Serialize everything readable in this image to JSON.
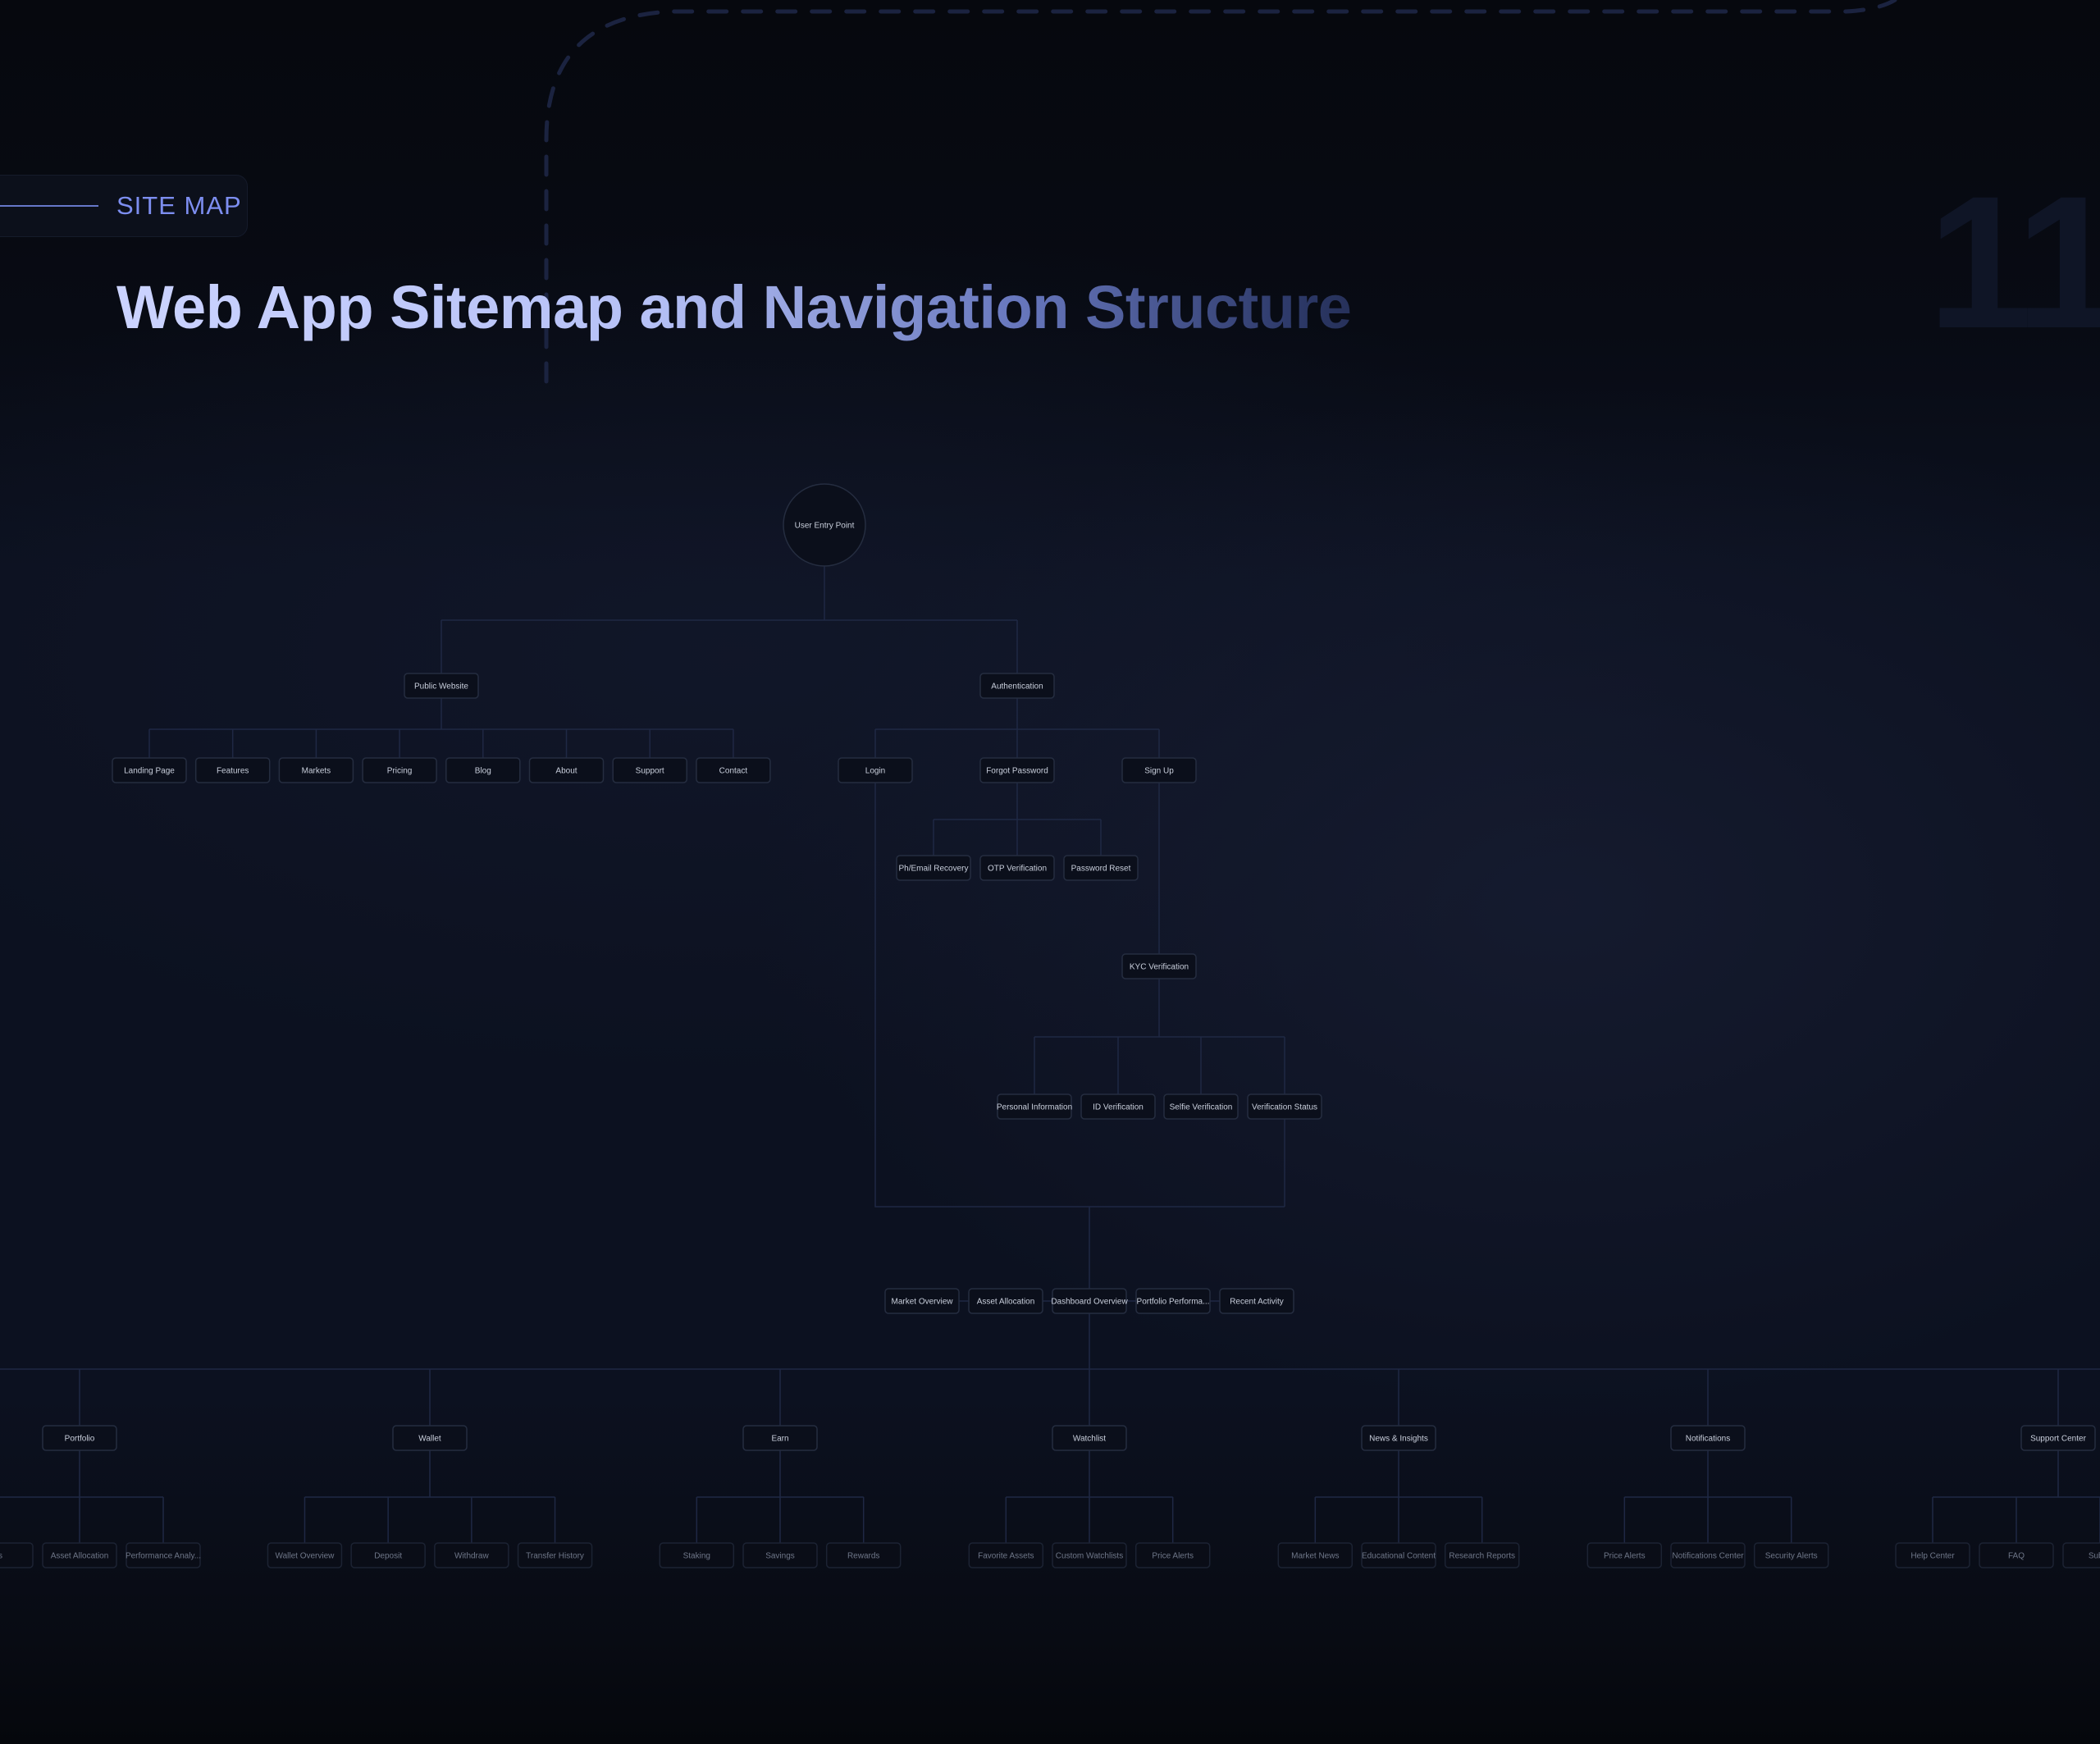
{
  "header": {
    "section_label": "SITE MAP",
    "title": "Web App Sitemap and Navigation Structure",
    "page_number": "11"
  },
  "sitemap": {
    "root": "User Entry Point",
    "public_website": {
      "label": "Public Website",
      "children": [
        "Landing Page",
        "Features",
        "Markets",
        "Pricing",
        "Blog",
        "About",
        "Support",
        "Contact"
      ]
    },
    "authentication": {
      "label": "Authentication",
      "login": "Login",
      "forgot_password": {
        "label": "Forgot Password",
        "children": [
          "Ph/Email Recovery",
          "OTP Verification",
          "Password Reset"
        ]
      },
      "sign_up": "Sign Up",
      "kyc": {
        "label": "KYC Verification",
        "children": [
          "Personal Information",
          "ID Verification",
          "Selfie Verification",
          "Verification Status"
        ]
      }
    },
    "dashboard": {
      "label": "Dashboard Overview",
      "left": [
        "Market Overview",
        "Asset Allocation"
      ],
      "right": [
        "Portfolio Performa...",
        "Recent Activity"
      ]
    },
    "sections": [
      {
        "label": "Portfolio",
        "children": [
          "ngs",
          "Asset Allocation",
          "Performance Analy..."
        ]
      },
      {
        "label": "Wallet",
        "children": [
          "Wallet Overview",
          "Deposit",
          "Withdraw",
          "Transfer History"
        ]
      },
      {
        "label": "Earn",
        "children": [
          "Staking",
          "Savings",
          "Rewards"
        ]
      },
      {
        "label": "Watchlist",
        "children": [
          "Favorite Assets",
          "Custom Watchlists",
          "Price Alerts"
        ]
      },
      {
        "label": "News & Insights",
        "children": [
          "Market News",
          "Educational Content",
          "Research Reports"
        ]
      },
      {
        "label": "Notifications",
        "children": [
          "Price Alerts",
          "Notifications Center",
          "Security Alerts"
        ]
      },
      {
        "label": "Support Center",
        "children": [
          "Help Center",
          "FAQ",
          "Submi"
        ]
      }
    ]
  }
}
